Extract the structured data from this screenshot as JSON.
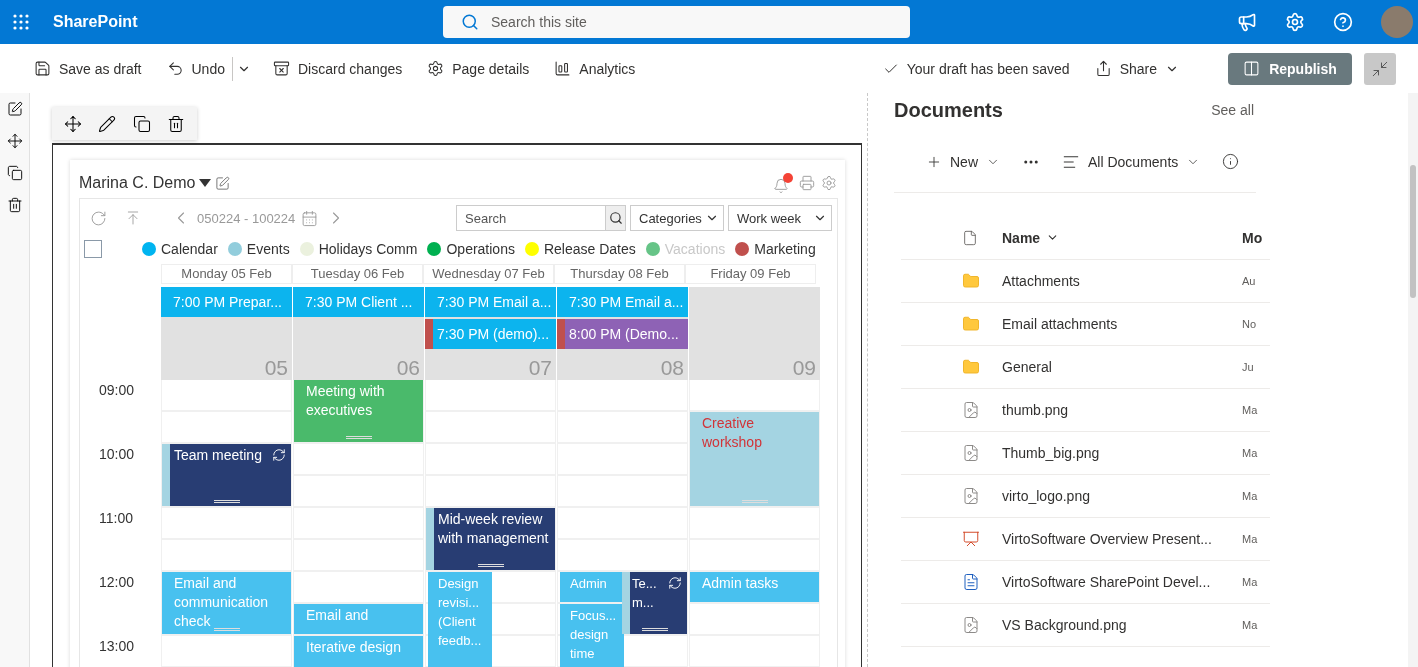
{
  "app_bar": {
    "brand": "SharePoint",
    "search_placeholder": "Search this site"
  },
  "command_bar": {
    "actions": [
      {
        "label": "Save as draft",
        "kind": "save"
      },
      {
        "label": "Undo",
        "kind": "undo"
      },
      {
        "label": "Discard changes",
        "kind": "discard"
      },
      {
        "label": "Page details",
        "kind": "details"
      },
      {
        "label": "Analytics",
        "kind": "analytics"
      }
    ],
    "status": "Your draft has been saved",
    "share": "Share",
    "publish": "Republish"
  },
  "calendar": {
    "title": "Marina C. Demo",
    "date_range": "050224 - 100224",
    "search_placeholder": "Search",
    "categories": "Categories",
    "view": "Work week",
    "select_all": {
      "checked": false
    },
    "legend": [
      {
        "label": "Calendar",
        "color": "#00b4f0",
        "disabled": false
      },
      {
        "label": "Events",
        "color": "#92cddc",
        "disabled": false
      },
      {
        "label": "Holidays Comm",
        "color": "#ebf1de",
        "disabled": false
      },
      {
        "label": "Operations",
        "color": "#00b050",
        "disabled": false
      },
      {
        "label": "Release Dates",
        "color": "#ffff00",
        "disabled": false
      },
      {
        "label": "Vacations",
        "color": "#66c487",
        "disabled": true
      },
      {
        "label": "Marketing",
        "color": "#c0504d",
        "disabled": false
      }
    ],
    "hours": [
      "09:00",
      "10:00",
      "11:00",
      "12:00",
      "13:00"
    ],
    "days": [
      {
        "label": "Monday 05 Feb",
        "number": "05",
        "all_day": [
          {
            "text": "7:00 PM Prepar...",
            "kind": "plain",
            "color": "#0cb4ee"
          }
        ],
        "events": [
          {
            "title": "Team meeting",
            "kind": "strip",
            "color": "#283d73",
            "recurring": true
          },
          {
            "title": "Email and communication check",
            "kind": "plain",
            "color": "#48c1ef",
            "recurring": false
          }
        ]
      },
      {
        "label": "Tuesday 06 Feb",
        "number": "06",
        "all_day": [
          {
            "text": "7:30 PM Client ...",
            "kind": "plain",
            "color": "#0cb4ee"
          }
        ],
        "events": [
          {
            "title": "Meeting with executives",
            "kind": "plain",
            "color": "#4aba6b",
            "recurring": false
          },
          {
            "title": "Email and",
            "kind": "plain",
            "color": "#48c1ef",
            "recurring": false
          },
          {
            "title": "Iterative design",
            "kind": "plain",
            "color": "#48c1ef",
            "recurring": false
          }
        ]
      },
      {
        "label": "Wednesday 07 Feb",
        "number": "07",
        "all_day": [
          {
            "text": "7:30 PM Email a...",
            "kind": "plain",
            "color": "#0cb4ee"
          },
          {
            "text": "7:30 PM (demo)...",
            "kind": "strip",
            "color": "#0cb4ee"
          }
        ],
        "events": [
          {
            "title": "Mid-week review with management",
            "kind": "strip",
            "color": "#283d73",
            "recurring": false
          },
          {
            "title": "Design revisi... (Client feedb...",
            "kind": "plain",
            "color": "#48c1ef",
            "recurring": false
          }
        ]
      },
      {
        "label": "Thursday 08 Feb",
        "number": "08",
        "all_day": [
          {
            "text": "7:30 PM Email a...",
            "kind": "plain",
            "color": "#0cb4ee"
          },
          {
            "text": "8:00 PM (Demo...",
            "kind": "strip",
            "color": "#8e62b5"
          }
        ],
        "events": [
          {
            "title": "Admin",
            "kind": "plain",
            "color": "#48c1ef",
            "recurring": false
          },
          {
            "title": "Focus... design time",
            "kind": "plain",
            "color": "#48c1ef",
            "recurring": false
          },
          {
            "title": "Te... m...",
            "kind": "strip",
            "color": "#283d73",
            "recurring": true
          }
        ]
      },
      {
        "label": "Friday 09 Feb",
        "number": "09",
        "events": [
          {
            "title": "Creative workshop",
            "kind": "alert",
            "color": "#a4d4e2",
            "recurring": false
          },
          {
            "title": "Admin tasks",
            "kind": "plain",
            "color": "#48c1ef",
            "recurring": false
          }
        ]
      }
    ]
  },
  "documents": {
    "title": "Documents",
    "see_all": "See all",
    "new": "New",
    "view": "All Documents",
    "columns": [
      "Name",
      "Mo"
    ],
    "rows": [
      {
        "name": "Attachments",
        "kind": "folder",
        "modified": "Au"
      },
      {
        "name": "Email attachments",
        "kind": "folder",
        "modified": "No"
      },
      {
        "name": "General",
        "kind": "folder",
        "modified": "Ju"
      },
      {
        "name": "thumb.png",
        "kind": "image",
        "modified": "Ma"
      },
      {
        "name": "Thumb_big.png",
        "kind": "image",
        "modified": "Ma"
      },
      {
        "name": "virto_logo.png",
        "kind": "image",
        "modified": "Ma"
      },
      {
        "name": "VirtoSoftware Overview Present...",
        "kind": "presentation",
        "modified": "Ma"
      },
      {
        "name": "VirtoSoftware SharePoint Devel...",
        "kind": "document",
        "modified": "Ma"
      },
      {
        "name": "VS Background.png",
        "kind": "image",
        "modified": "Ma"
      }
    ]
  }
}
